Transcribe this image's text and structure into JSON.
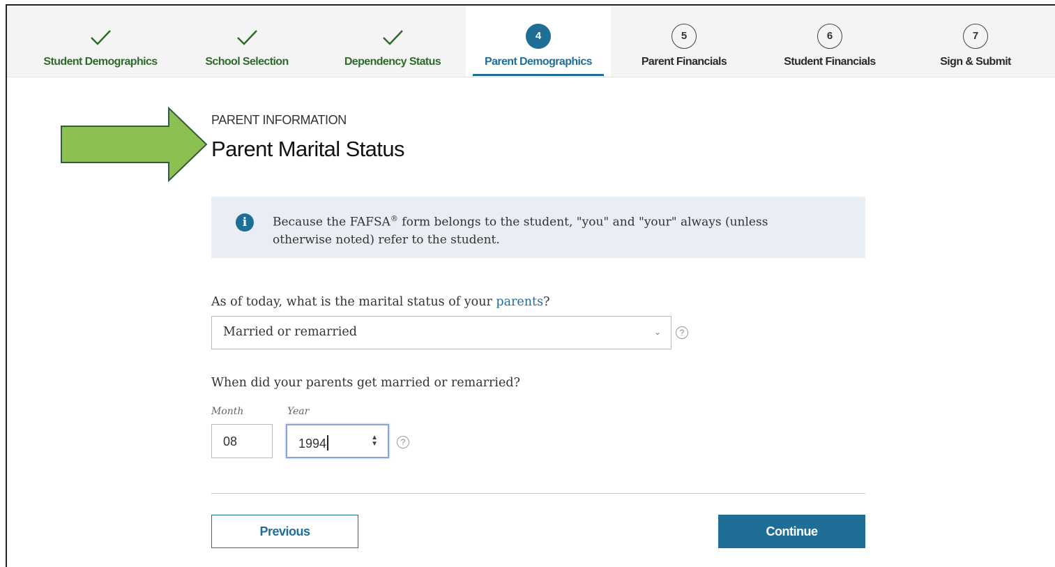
{
  "stepper": {
    "steps": [
      {
        "label": "Student Demographics",
        "state": "done"
      },
      {
        "label": "School Selection",
        "state": "done"
      },
      {
        "label": "Dependency Status",
        "state": "done"
      },
      {
        "label": "Parent Demographics",
        "state": "active",
        "number": "4"
      },
      {
        "label": "Parent Financials",
        "state": "todo",
        "number": "5"
      },
      {
        "label": "Student Financials",
        "state": "todo",
        "number": "6"
      },
      {
        "label": "Sign & Submit",
        "state": "todo",
        "number": "7"
      }
    ]
  },
  "section": {
    "eyebrow": "PARENT INFORMATION",
    "title": "Parent Marital Status"
  },
  "info": {
    "icon": "info-icon",
    "icon_glyph": "i",
    "text_before": "Because the FAFSA",
    "registered": "®",
    "text_after": " form belongs to the student, \"you\" and \"your\" always (unless otherwise noted) refer to the student."
  },
  "question1": {
    "text_before": "As of today, what is the marital status of your ",
    "link": "parents",
    "text_after": "?",
    "selected": "Married or remarried"
  },
  "question2": {
    "text": "When did your parents get married or remarried?",
    "month_label": "Month",
    "month_value": "08",
    "year_label": "Year",
    "year_value": "1994"
  },
  "buttons": {
    "previous": "Previous",
    "continue": "Continue"
  },
  "colors": {
    "accent": "#1f6e96",
    "done": "#2e6b2a",
    "arrow": "#8cc152"
  }
}
